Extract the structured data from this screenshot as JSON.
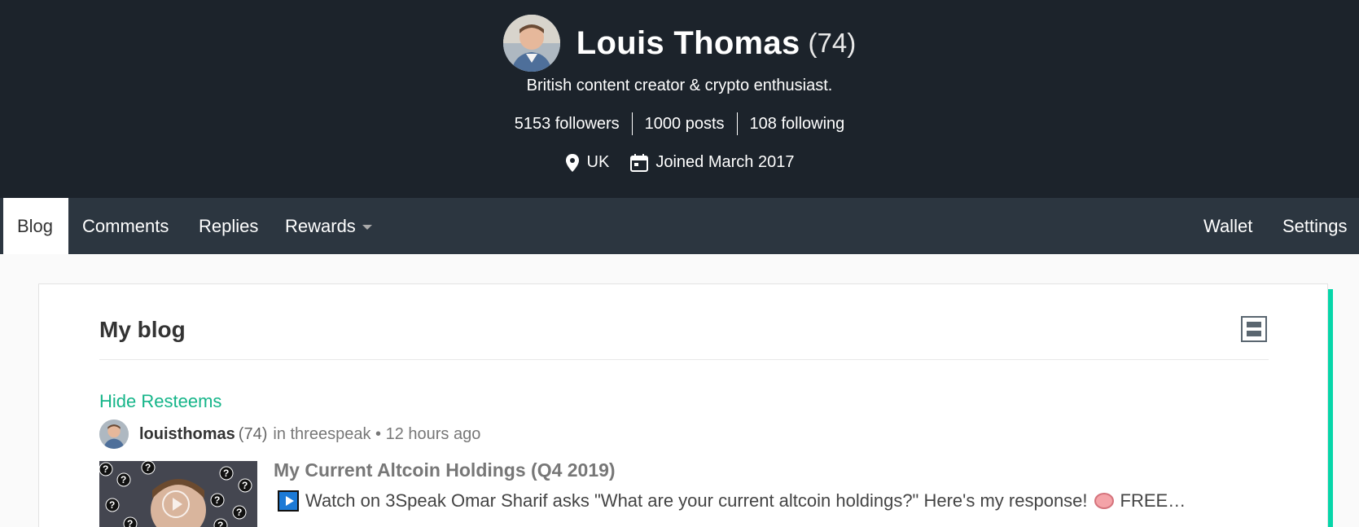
{
  "profile": {
    "name": "Louis Thomas",
    "reputation": "(74)",
    "about": "British content creator & crypto enthusiast.",
    "stats": {
      "followers": "5153 followers",
      "posts": "1000 posts",
      "following": "108 following"
    },
    "location": "UK",
    "joined": "Joined March 2017"
  },
  "nav": {
    "tabs": [
      "Blog",
      "Comments",
      "Replies",
      "Rewards"
    ],
    "right_tabs": [
      "Wallet",
      "Settings"
    ],
    "active": "Blog"
  },
  "blog": {
    "title": "My blog",
    "hide_resteems": "Hide Resteems",
    "post": {
      "author": "louisthomas",
      "author_rep": "(74)",
      "context": "in threespeak • 12 hours ago",
      "title": "My Current Altcoin Holdings (Q4 2019)",
      "body_start": "Watch on 3Speak Omar Sharif asks \"What are your current altcoin holdings?\" Here's my response!",
      "body_end": "FREE…"
    }
  },
  "colors": {
    "header_bg": "#1c232b",
    "nav_bg": "#2c3640",
    "accent": "#06d6a9",
    "link": "#15b589"
  },
  "icons": {
    "location": "location-pin-icon",
    "calendar": "calendar-icon",
    "dropdown": "chevron-down-icon",
    "layout": "layout-toggle-icon",
    "video": "play-button-icon",
    "brain": "brain-emoji-icon"
  }
}
